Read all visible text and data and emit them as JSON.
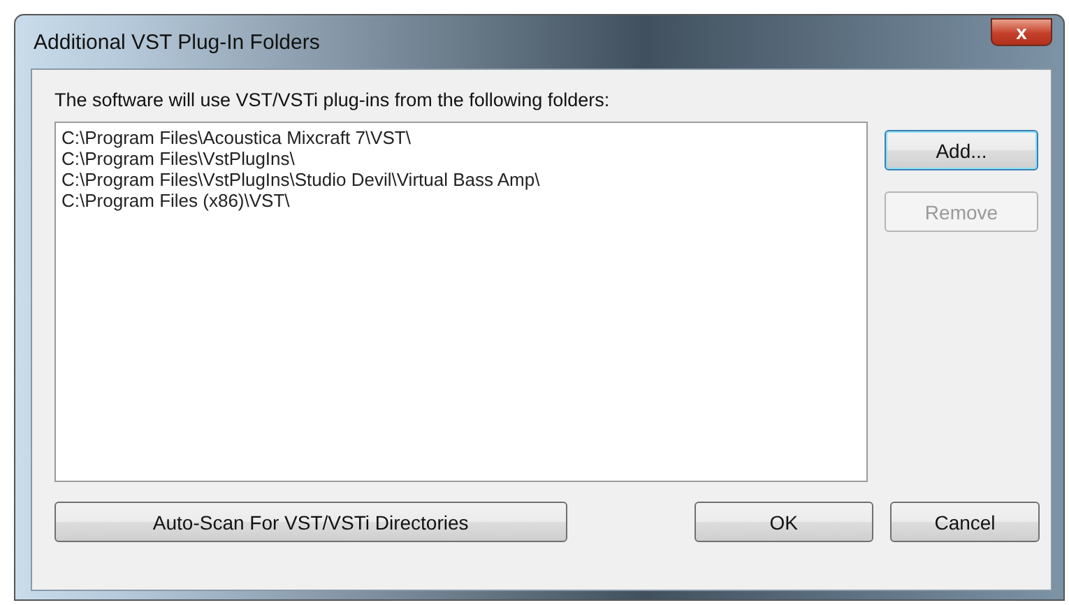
{
  "window": {
    "title": "Additional VST Plug-In Folders",
    "close": "x"
  },
  "instruction": "The software will use VST/VSTi plug-ins from the following folders:",
  "folders": [
    {
      "path": "C:\\Program Files\\Acoustica Mixcraft 7\\VST\\",
      "selected": false
    },
    {
      "path": "C:\\Program Files\\VstPlugIns\\",
      "selected": false
    },
    {
      "path": "C:\\Program Files\\VstPlugIns\\Studio Devil\\Virtual Bass Amp\\",
      "selected": false
    },
    {
      "path": "C:\\Program Files (x86)\\VST\\",
      "selected": false
    }
  ],
  "side_buttons": [
    {
      "label": "Add...",
      "disabled": false,
      "focused": true
    },
    {
      "label": "Remove",
      "disabled": true,
      "focused": false
    }
  ],
  "bottom_buttons": [
    {
      "label": "Auto-Scan For VST/VSTi Directories"
    },
    {
      "label": "OK"
    },
    {
      "label": "Cancel"
    }
  ]
}
